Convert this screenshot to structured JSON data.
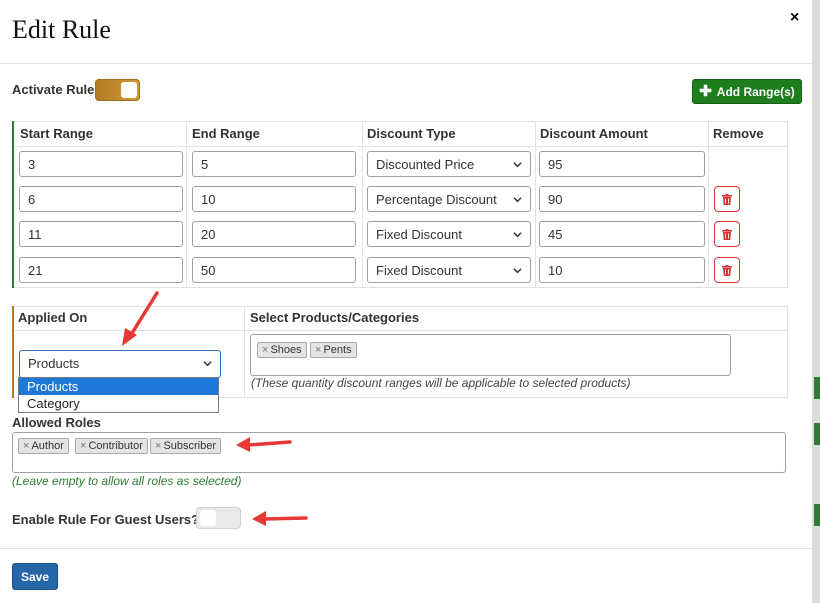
{
  "dialog": {
    "title": "Edit Rule",
    "close_label": "×"
  },
  "activate": {
    "label": "Activate Rule",
    "enabled": true
  },
  "add_ranges": {
    "label": "Add Range(s)"
  },
  "ranges_table": {
    "headers": [
      "Start Range",
      "End Range",
      "Discount Type",
      "Discount Amount",
      "Remove"
    ],
    "rows": [
      {
        "start": "3",
        "end": "5",
        "type": "Discounted Price",
        "amount": "95",
        "removable": false
      },
      {
        "start": "6",
        "end": "10",
        "type": "Percentage Discount",
        "amount": "90",
        "removable": true
      },
      {
        "start": "11",
        "end": "20",
        "type": "Fixed Discount",
        "amount": "45",
        "removable": true
      },
      {
        "start": "21",
        "end": "50",
        "type": "Fixed Discount",
        "amount": "10",
        "removable": true
      }
    ]
  },
  "applied_on": {
    "label": "Applied On",
    "selected": "Products",
    "options": [
      "Products",
      "Category"
    ]
  },
  "select_products": {
    "label": "Select Products/Categories",
    "tags": [
      "Shoes",
      "Pents"
    ],
    "hint": "(These quantity discount ranges will be applicable to selected products)"
  },
  "allowed_roles": {
    "label": "Allowed Roles",
    "tags": [
      "Author",
      "Contributor",
      "Subscriber"
    ],
    "hint": "(Leave empty to allow all roles as selected)"
  },
  "guest": {
    "label": "Enable Rule For Guest Users?",
    "enabled": false
  },
  "footer": {
    "save_label": "Save"
  },
  "colors": {
    "toggle_on": "#c18a2e",
    "add_button": "#1e7e1e",
    "save_button": "#2566a8",
    "remove_icon": "#dd3333",
    "annotation_arrow": "#e53935",
    "hint_green": "#2e7d32",
    "option_highlight": "#1e78d7"
  },
  "icons": {
    "add": "plus-icon",
    "remove": "trash-icon",
    "select": "chevron-down-icon",
    "tag_remove": "x-icon"
  }
}
